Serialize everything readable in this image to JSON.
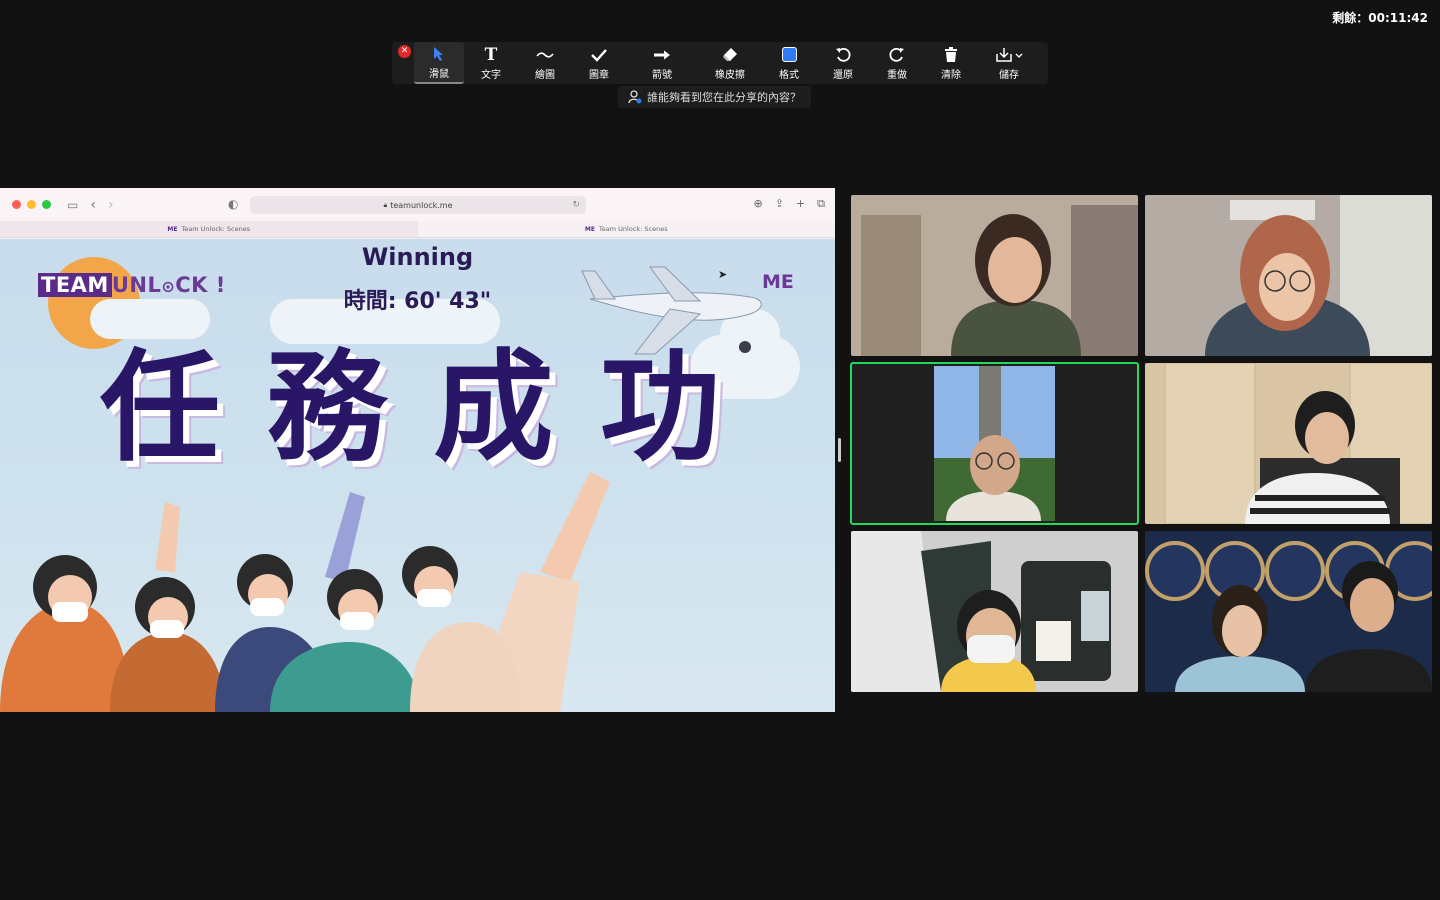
{
  "timer": {
    "text": "剩餘：00:11:42"
  },
  "toolbar": {
    "tools": [
      {
        "label": "滑鼠",
        "icon": "pointer-arrow-icon",
        "active": true
      },
      {
        "label": "文字",
        "icon": "text-icon"
      },
      {
        "label": "繪圖",
        "icon": "draw-icon"
      },
      {
        "label": "圖章",
        "icon": "stamp-check-icon"
      },
      {
        "label": "箭號",
        "icon": "arrow-icon"
      },
      {
        "label": "橡皮擦",
        "icon": "eraser-icon"
      },
      {
        "label": "格式",
        "icon": "format-icon"
      },
      {
        "label": "還原",
        "icon": "undo-icon"
      },
      {
        "label": "重做",
        "icon": "redo-icon"
      },
      {
        "label": "清除",
        "icon": "trash-icon"
      },
      {
        "label": "儲存",
        "icon": "save-icon"
      }
    ],
    "who_sees": "誰能夠看到您在此分享的內容？"
  },
  "browser": {
    "url": "teamunlock.me",
    "tabs": [
      {
        "logo": "ME",
        "title": "Team Unlock: Scenes"
      },
      {
        "logo": "ME",
        "title": "Team Unlock: Scenes"
      }
    ]
  },
  "scene": {
    "logo_part1": "TEAM",
    "logo_part2": "UNL",
    "logo_part3": "CK !",
    "me_logo": "ME",
    "winning": "Winning",
    "time": "時間: 60' 43\"",
    "big_title_chars": [
      "任",
      "務",
      "成",
      "功"
    ]
  },
  "colors": {
    "speaking_border": "#23d959",
    "brand_purple": "#5b2b8a"
  }
}
